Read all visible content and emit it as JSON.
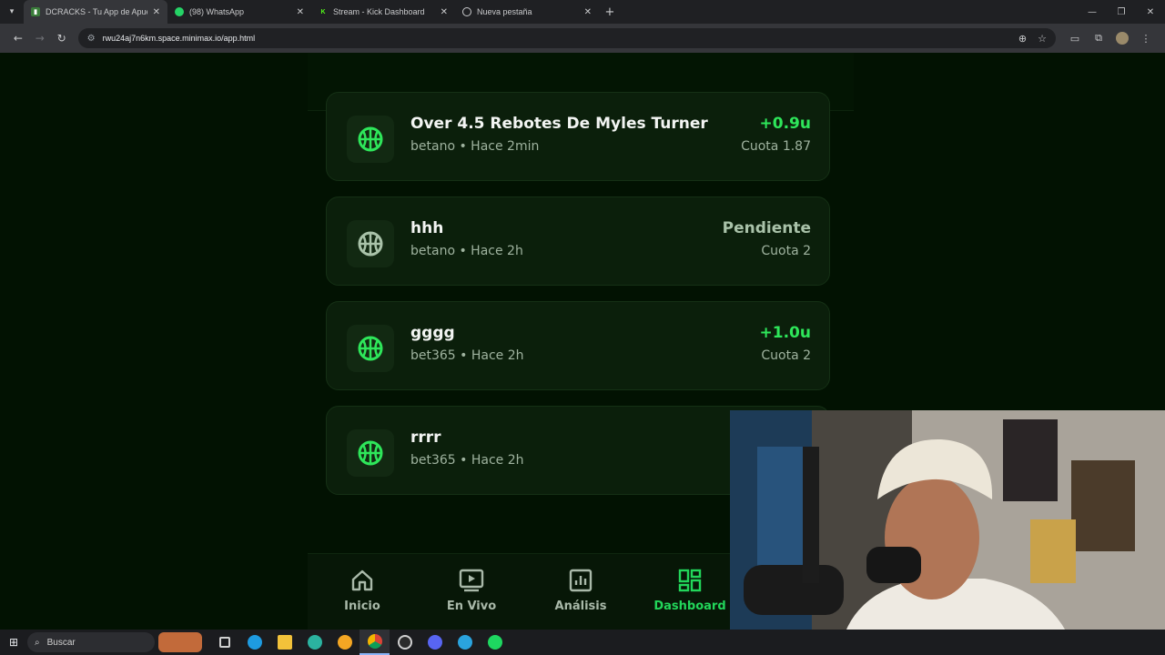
{
  "browser": {
    "tabs": [
      {
        "title": "DCRACKS - Tu App de Apuestas",
        "favicon": "chart-icon",
        "active": true
      },
      {
        "title": "(98) WhatsApp",
        "favicon": "whatsapp-icon",
        "active": false
      },
      {
        "title": "Stream - Kick Dashboard",
        "favicon": "kick-icon",
        "active": false
      },
      {
        "title": "Nueva pestaña",
        "favicon": "globe-icon",
        "active": false
      }
    ],
    "url": "rwu24aj7n6km.space.minimax.io/app.html"
  },
  "bets": [
    {
      "title": "Over 4.5 Rebotes De Myles Turner",
      "meta": "betano • Hace 2min",
      "result": "+0.9u",
      "odds": "Cuota 1.87",
      "status": "won"
    },
    {
      "title": "hhh",
      "meta": "betano • Hace 2h",
      "result": "Pendiente",
      "odds": "Cuota 2",
      "status": "pending"
    },
    {
      "title": "gggg",
      "meta": "bet365 • Hace 2h",
      "result": "+1.0u",
      "odds": "Cuota 2",
      "status": "won"
    },
    {
      "title": "rrrr",
      "meta": "bet365 • Hace 2h",
      "result": "",
      "odds": "",
      "status": "won"
    }
  ],
  "bottom_nav": [
    {
      "label": "Inicio",
      "icon": "home-icon",
      "active": false
    },
    {
      "label": "En Vivo",
      "icon": "live-play-icon",
      "active": false
    },
    {
      "label": "Análisis",
      "icon": "analysis-chart-icon",
      "active": false
    },
    {
      "label": "Dashboard",
      "icon": "dashboard-grid-icon",
      "active": true
    }
  ],
  "taskbar": {
    "search_label": "Buscar"
  },
  "colors": {
    "accent": "#22d65a",
    "won": "#2ee65a",
    "pending": "#a9c2a9",
    "background": "#021202"
  }
}
